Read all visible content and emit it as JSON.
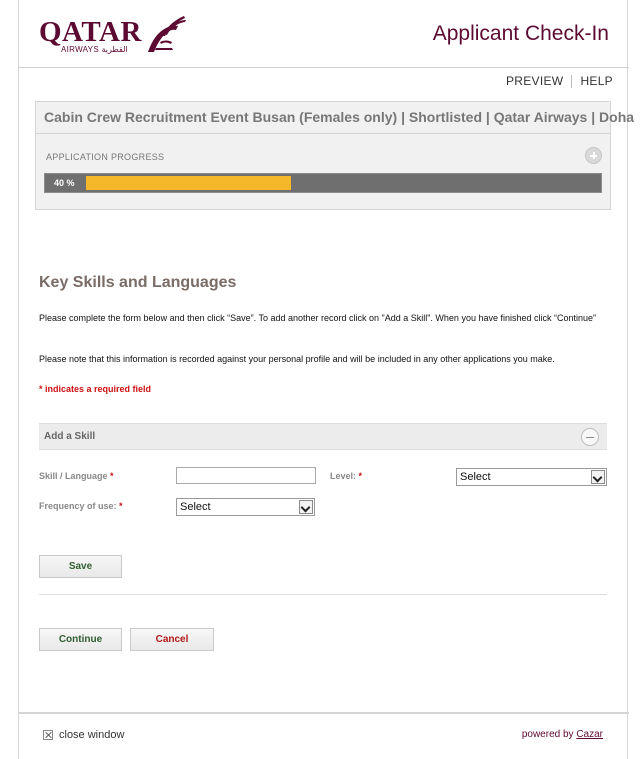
{
  "header": {
    "logo_word": "QATAR",
    "logo_sub": "AIRWAYS القطرية",
    "app_title": "Applicant Check-In"
  },
  "toplinks": {
    "preview": "PREVIEW",
    "help": "HELP"
  },
  "event": {
    "title": "Cabin Crew Recruitment Event Busan (Females only) | Shortlisted | Qatar Airways | Doha",
    "progress_label": "APPLICATION PROGRESS",
    "progress_text": "40 %",
    "progress_value": 0.4
  },
  "main": {
    "section_title": "Key Skills and Languages",
    "para1": "Please complete the form below and then click “Save”. To add another record click on \"Add a Skill\". When you have finished click “Continue”",
    "para2": "Please note that this information is recorded against your personal profile and will be included in any other applications you make.",
    "required_note": "* indicates a required field"
  },
  "form": {
    "panel_title": "Add a Skill",
    "skill_label": "Skill / Language",
    "level_label": "Level:",
    "frequency_label": "Frequency of use:",
    "required_mark": "*",
    "skill_value": "",
    "level_selected": "Select",
    "frequency_selected": "Select",
    "save_label": "Save",
    "continue_label": "Continue",
    "cancel_label": "Cancel"
  },
  "footer": {
    "close_label": "close window",
    "powered_by": "powered by",
    "vendor": "Cazar"
  },
  "colors": {
    "brand": "#5c0a32",
    "progress_fill": "#f5b82a",
    "required": "#cc1111"
  },
  "icons": [
    "qatar-airways-oryx-logo",
    "plus-circle-icon",
    "minus-circle-icon",
    "chevron-down-icon",
    "close-box-icon"
  ]
}
